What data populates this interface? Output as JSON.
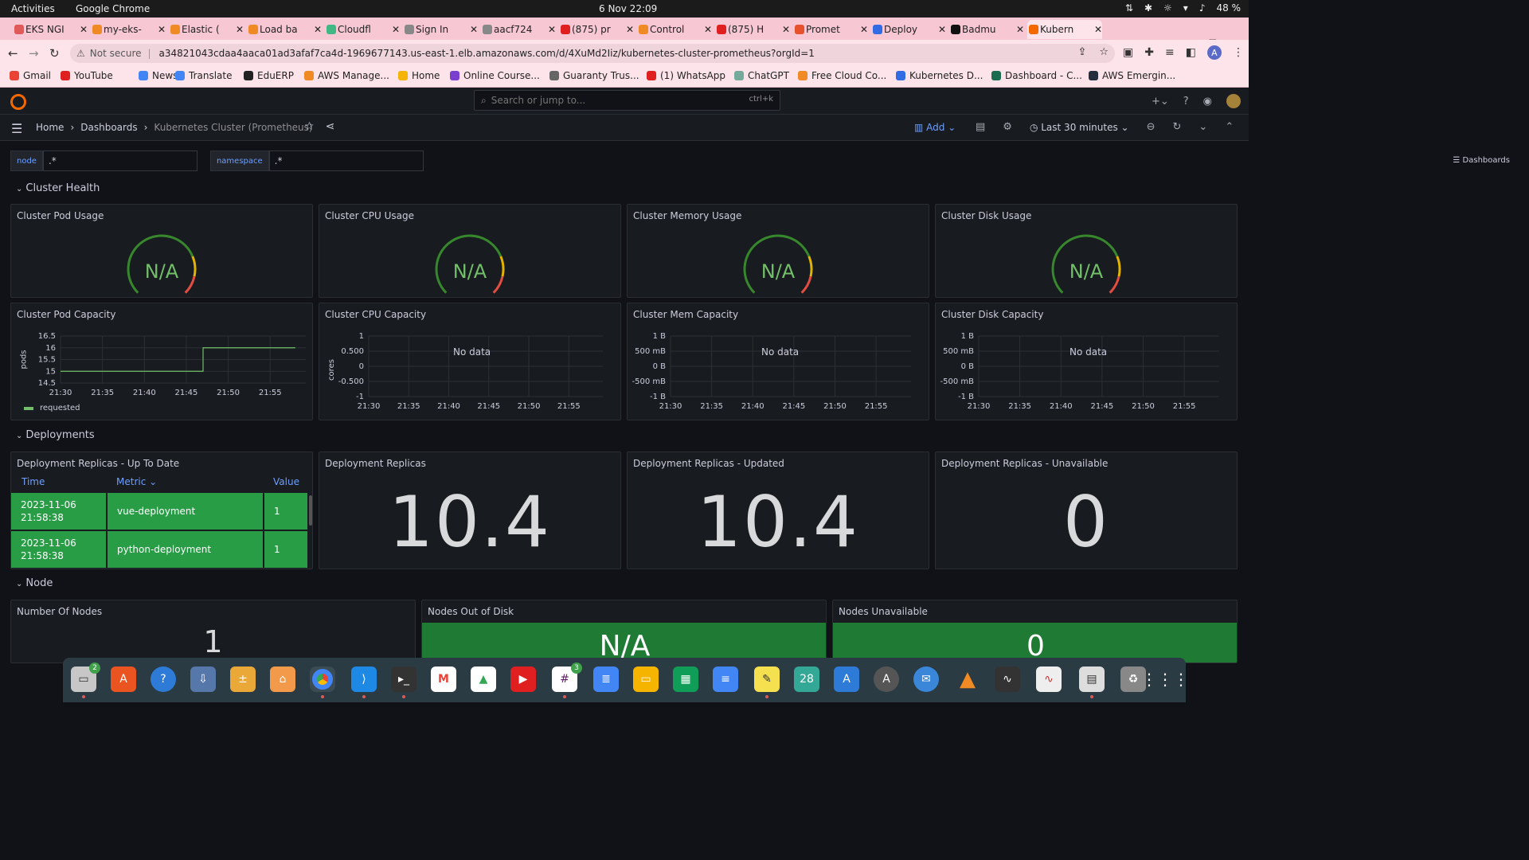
{
  "os": {
    "activities": "Activities",
    "app": "Google Chrome",
    "clock": "6 Nov  22:09",
    "battery": "48 %"
  },
  "tabs": [
    {
      "label": "EKS NGI",
      "color": "#e05a5a"
    },
    {
      "label": "my-eks-",
      "color": "#f08a24"
    },
    {
      "label": "Elastic (",
      "color": "#f08a24"
    },
    {
      "label": "Load ba",
      "color": "#f08a24"
    },
    {
      "label": "Cloudfl",
      "color": "#41b883"
    },
    {
      "label": "Sign In",
      "color": "#888888"
    },
    {
      "label": "aacf724",
      "color": "#888888"
    },
    {
      "label": "(875) pr",
      "color": "#e02020"
    },
    {
      "label": "Control",
      "color": "#f08a24"
    },
    {
      "label": "(875) H",
      "color": "#e02020"
    },
    {
      "label": "Promet",
      "color": "#e6522c"
    },
    {
      "label": "Deploy",
      "color": "#326ce5"
    },
    {
      "label": "Badmu",
      "color": "#111111"
    },
    {
      "label": "Kubern",
      "color": "#f46800"
    }
  ],
  "address": {
    "not_secure": "Not secure",
    "url": "a34821043cdaa4aaca01ad3afaf7ca4d-1969677143.us-east-1.elb.amazonaws.com/d/4XuMd2Iiz/kubernetes-cluster-prometheus?orgId=1",
    "avatar": "A"
  },
  "bookmarks": [
    {
      "label": "Gmail",
      "color": "#ea4335"
    },
    {
      "label": "YouTube",
      "color": "#e02020"
    },
    {
      "label": "News",
      "color": "#4285f4"
    },
    {
      "label": "Translate",
      "color": "#4285f4"
    },
    {
      "label": "EduERP",
      "color": "#222222"
    },
    {
      "label": "AWS Manage...",
      "color": "#f08a24"
    },
    {
      "label": "Home",
      "color": "#f5b400"
    },
    {
      "label": "Online Course...",
      "color": "#7b3fd0"
    },
    {
      "label": "Guaranty Trus...",
      "color": "#666666"
    },
    {
      "label": "(1) WhatsApp",
      "color": "#e02020"
    },
    {
      "label": "ChatGPT",
      "color": "#74aa9c"
    },
    {
      "label": "Free Cloud Co...",
      "color": "#f08a24"
    },
    {
      "label": "Kubernetes D...",
      "color": "#326ce5"
    },
    {
      "label": "Dashboard - C...",
      "color": "#1a6b50"
    },
    {
      "label": "AWS Emergin...",
      "color": "#232f3e"
    }
  ],
  "grafana": {
    "search_placeholder": "Search or jump to...",
    "search_kbd": "ctrl+k",
    "breadcrumb": [
      "Home",
      "Dashboards",
      "Kubernetes Cluster (Prometheus)"
    ],
    "add": "Add",
    "time_range": "Last 30 minutes",
    "dashboards_link": "Dashboards"
  },
  "variables": [
    {
      "name": "node",
      "value": ".*"
    },
    {
      "name": "namespace",
      "value": ".*"
    }
  ],
  "rows": {
    "cluster_health": "Cluster Health",
    "deployments": "Deployments",
    "node": "Node"
  },
  "gauges": [
    {
      "title": "Cluster Pod Usage",
      "value": "N/A"
    },
    {
      "title": "Cluster CPU Usage",
      "value": "N/A"
    },
    {
      "title": "Cluster Memory Usage",
      "value": "N/A"
    },
    {
      "title": "Cluster Disk Usage",
      "value": "N/A"
    }
  ],
  "capacity": {
    "pod": {
      "title": "Cluster Pod Capacity",
      "ylabel": "pods",
      "yticks": [
        "16.5",
        "16",
        "15.5",
        "15",
        "14.5"
      ],
      "legend": "requested"
    },
    "cpu": {
      "title": "Cluster CPU Capacity",
      "ylabel": "cores",
      "yticks": [
        "1",
        "0.500",
        "0",
        "-0.500",
        "-1"
      ],
      "no_data": "No data"
    },
    "mem": {
      "title": "Cluster Mem Capacity",
      "yticks": [
        "1 B",
        "500 mB",
        "0 B",
        "-500 mB",
        "-1 B"
      ],
      "no_data": "No data"
    },
    "disk": {
      "title": "Cluster Disk Capacity",
      "yticks": [
        "1 B",
        "500 mB",
        "0 B",
        "-500 mB",
        "-1 B"
      ],
      "no_data": "No data"
    },
    "xticks": [
      "21:30",
      "21:35",
      "21:40",
      "21:45",
      "21:50",
      "21:55"
    ]
  },
  "deploy_table": {
    "title": "Deployment Replicas - Up To Date",
    "headers": [
      "Time",
      "Metric",
      "Value"
    ],
    "rows": [
      {
        "time": "2023-11-06 21:58:38",
        "metric": "vue-deployment",
        "value": "1"
      },
      {
        "time": "2023-11-06 21:58:38",
        "metric": "python-deployment",
        "value": "1"
      }
    ]
  },
  "stats": {
    "replicas": {
      "title": "Deployment Replicas",
      "value": "10.4"
    },
    "updated": {
      "title": "Deployment Replicas - Updated",
      "value": "10.4"
    },
    "unavailable": {
      "title": "Deployment Replicas - Unavailable",
      "value": "0"
    }
  },
  "nodes": {
    "count": {
      "title": "Number Of Nodes",
      "value": "1"
    },
    "out_of_disk": {
      "title": "Nodes Out of Disk",
      "value": "N/A"
    },
    "unavailable": {
      "title": "Nodes Unavailable",
      "value": "0"
    }
  },
  "dock": {
    "files_badge": "2",
    "slack_badge": "3",
    "calendar": "28"
  },
  "chart_data": [
    {
      "type": "line",
      "title": "Cluster Pod Capacity",
      "ylabel": "pods",
      "ylim": [
        14.5,
        16.5
      ],
      "x": [
        "21:30",
        "21:35",
        "21:40",
        "21:45",
        "21:50",
        "21:55"
      ],
      "series": [
        {
          "name": "requested",
          "x": [
            "21:29",
            "21:47",
            "21:47",
            "21:58"
          ],
          "values": [
            15,
            15,
            16,
            16
          ]
        }
      ]
    }
  ]
}
